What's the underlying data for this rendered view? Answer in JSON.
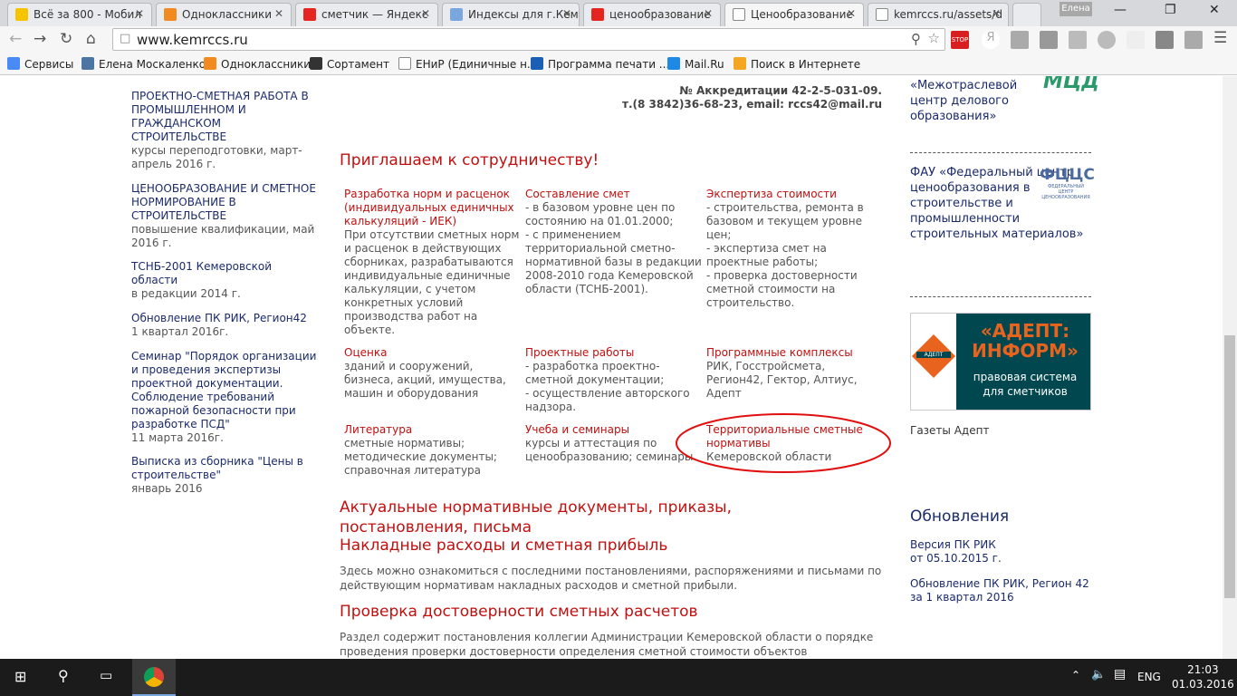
{
  "browser": {
    "tabs": [
      {
        "title": "Всё за 800 - Мобил",
        "icon": "beeline-icon",
        "color": "#f6c400"
      },
      {
        "title": "Одноклассники",
        "icon": "ok-icon",
        "color": "#f28b1f"
      },
      {
        "title": "сметчик — Яндекс",
        "icon": "yandex-icon",
        "color": "#e52620"
      },
      {
        "title": "Индексы для г.Кем",
        "icon": "site-icon",
        "color": "#7aa7e0"
      },
      {
        "title": "ценообразование",
        "icon": "yandex-icon",
        "color": "#e52620"
      },
      {
        "title": "Ценообразование",
        "icon": "page-icon",
        "color": "#ffffff"
      },
      {
        "title": "kemrccs.ru/assets/d",
        "icon": "page-icon",
        "color": "#ffffff"
      }
    ],
    "user": "Елена",
    "url": "www.kemrccs.ru",
    "bookmarks": [
      {
        "label": "Сервисы",
        "color": "#4a8af4"
      },
      {
        "label": "Елена Москаленко",
        "color": "#4c75a3"
      },
      {
        "label": "Одноклассники",
        "color": "#f28b1f"
      },
      {
        "label": "Сортамент",
        "color": "#333333"
      },
      {
        "label": "ЕНиР (Единичные н...",
        "color": "#ffffff"
      },
      {
        "label": "Программа печати ...",
        "color": "#1a5fb4"
      },
      {
        "label": "Mail.Ru",
        "color": "#1e88e5"
      },
      {
        "label": "Поиск в Интернете",
        "color": "#f5a623"
      }
    ]
  },
  "left": [
    {
      "title": "ПРОЕКТНО-СМЕТНАЯ РАБОТА В ПРОМЫШЛЕННОМ И ГРАЖДАНСКОМ СТРОИТЕЛЬСТВЕ",
      "sub": "курсы переподготовки, март-апрель 2016 г."
    },
    {
      "title": "ЦЕНООБРАЗОВАНИЕ И СМЕТНОЕ НОРМИРОВАНИЕ В СТРОИТЕЛЬСТВЕ",
      "sub": "повышение квалификации, май 2016 г."
    },
    {
      "title": "ТСНБ-2001 Кемеровской области",
      "sub": "в редакции 2014 г."
    },
    {
      "title": "Обновление ПК РИК, Регион42",
      "sub": "1 квартал 2016г."
    },
    {
      "title": "Семинар \"Порядок организации и проведения экспертизы проектной документации. Соблюдение требований пожарной безопасности при разработке ПСД\"",
      "sub": "11 марта 2016г."
    },
    {
      "title": "Выписка из сборника \"Цены в строительстве\"",
      "sub": "январь 2016"
    }
  ],
  "main": {
    "accreditation": "№ Аккредитации 42-2-5-031-09.",
    "contacts": "т.(8 3842)36-68-23, email: rccs42@mail.ru",
    "invite": "Приглашаем к сотрудничеству!",
    "services": [
      {
        "title": "Разработка норм и расценок (индивидуальных единичных калькуляций - ИЕК)",
        "text": "При отсутствии сметных норм и расценок в действующих сборниках, разрабатываются индивидуальные единичные калькуляции, с учетом конкретных условий производства работ на объекте."
      },
      {
        "title": "Составление смет",
        "text": "- в базовом уровне цен по состоянию на 01.01.2000;\n- с применением территориальной сметно-нормативной базы в редакции 2008-2010 года Кемеровской области (ТСНБ-2001)."
      },
      {
        "title": "Экспертиза стоимости",
        "text": "- строительства, ремонта в базовом и текущем уровне цен;\n- экспертиза смет на проектные работы;\n- проверка достоверности сметной стоимости на строительство."
      },
      {
        "title": "Оценка",
        "text": "зданий и сооружений, бизнеса, акций, имущества, машин и оборудования"
      },
      {
        "title": "Проектные работы",
        "text": "- разработка проектно-сметной документации;\n- осуществление авторского надзора."
      },
      {
        "title": "Программные комплексы",
        "text": "РИК, Госстройсмета, Регион42, Гектор, Алтиус, Адепт"
      },
      {
        "title": "Литература",
        "text": "сметные нормативы; методические документы; справочная литература"
      },
      {
        "title": "Учеба и семинары",
        "text": "курсы и аттестация по ценообразованию; семинары"
      },
      {
        "title": "Территориальные сметные нормативы",
        "text": "Кемеровской области"
      }
    ],
    "docs_heading": "Актуальные нормативные документы, приказы, постановления, письма",
    "overhead_heading": "Накладные расходы и сметная прибыль",
    "overhead_text": "Здесь можно ознакомиться с последними постановлениями, распоряжениями и письмами по действующим нормативам накладных расходов и сметной прибыли.",
    "check_heading": "Проверка достоверности сметных расчетов",
    "check_text": "Раздел содержит постановления коллегии Администрации Кемеровской области о порядке проведения проверки достоверности определения сметной стоимости объектов капитального"
  },
  "right": {
    "mcdo": "«Межотраслевой центр делового образования»",
    "mcdo_logo": "МЦДО",
    "fau": "ФАУ «Федеральный центр ценообразования в строительстве и промышленности строительных материалов»",
    "fccs_logo": "ФЦЦС",
    "fccs_logo_sub": "ФЕДЕРАЛЬНЫЙ ЦЕНТР ЦЕНООБРАЗОВАНИЯ",
    "adept_title": "«АДЕПТ: ИНФОРМ»",
    "adept_sub": "правовая система для сметчиков",
    "adept_logo": "АДЕПТ",
    "adept_link": "Газеты Адепт",
    "updates_heading": "Обновления",
    "updates": [
      {
        "title": "Версия ПК РИК",
        "sub": "от 05.10.2015 г."
      },
      {
        "title": "Обновление ПК РИК, Регион 42",
        "sub": "за 1 квартал 2016"
      }
    ]
  },
  "taskbar": {
    "lang": "ENG",
    "time": "21:03",
    "date": "01.03.2016"
  }
}
